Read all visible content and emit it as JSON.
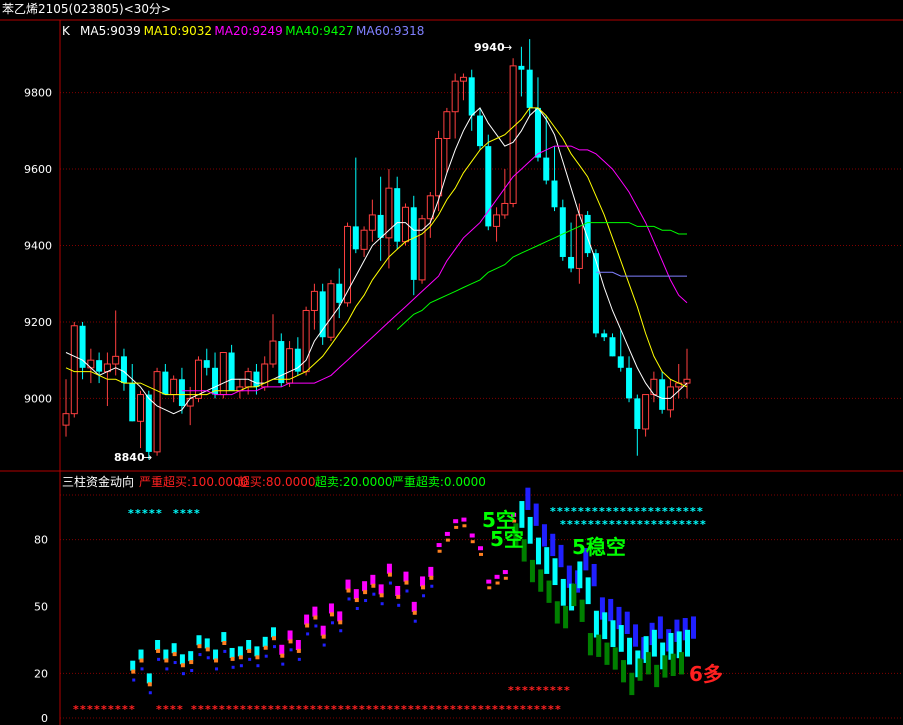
{
  "window": {
    "symbol": "苯乙烯2105",
    "code": "(023805)",
    "period": "<30分>"
  },
  "upper_panel": {
    "label": "K",
    "ma_legend": [
      {
        "text": "MA5:9039",
        "color": "#ffffff"
      },
      {
        "text": "MA10:9032",
        "color": "#ffff00"
      },
      {
        "text": "MA20:9249",
        "color": "#ff00ff"
      },
      {
        "text": "MA40:9427",
        "color": "#00ff00"
      },
      {
        "text": "MA60:9318",
        "color": "#8080ff"
      }
    ],
    "high_marker": "9940",
    "low_marker": "8840",
    "y_ticks": [
      "9800",
      "9600",
      "9400",
      "9200",
      "9000"
    ]
  },
  "lower_panel": {
    "title": "三柱资金动向",
    "legend": [
      {
        "text": "严重超买:100.0000",
        "color": "#ff2020"
      },
      {
        "text": "超买:80.0000",
        "color": "#ff2020"
      },
      {
        "text": "超卖:20.0000",
        "color": "#00ff00"
      },
      {
        "text": "严重超卖:0.0000",
        "color": "#00ff00"
      }
    ],
    "y_ticks": [
      "80",
      "50",
      "20",
      "0"
    ],
    "annotations": [
      {
        "text": "5空",
        "color": "#00ff00"
      },
      {
        "text": "5空",
        "color": "#00ff00"
      },
      {
        "text": "5稳空",
        "color": "#00ff00"
      },
      {
        "text": "6多",
        "color": "#ff2020"
      }
    ]
  },
  "colors": {
    "up": "#ff4040",
    "down": "#00ffff",
    "grid": "#800000",
    "axis": "#b00000"
  },
  "chart_data": [
    {
      "type": "candlestick",
      "title": "",
      "ylim": [
        8810,
        9990
      ],
      "y_ticks": [
        9000,
        9200,
        9400,
        9600,
        9800
      ],
      "grid": true,
      "series": [
        {
          "name": "K",
          "ohlc": [
            [
              8930,
              9050,
              8900,
              8960
            ],
            [
              8960,
              9200,
              8950,
              9190
            ],
            [
              9190,
              9200,
              9050,
              9080
            ],
            [
              9080,
              9130,
              9040,
              9100
            ],
            [
              9100,
              9120,
              9040,
              9070
            ],
            [
              9070,
              9120,
              8980,
              9090
            ],
            [
              9090,
              9230,
              9060,
              9110
            ],
            [
              9110,
              9130,
              9020,
              9040
            ],
            [
              9040,
              9090,
              8940,
              8940
            ],
            [
              8940,
              9020,
              8870,
              9010
            ],
            [
              9010,
              9020,
              8840,
              8860
            ],
            [
              8860,
              9080,
              8850,
              9070
            ],
            [
              9070,
              9090,
              9010,
              9010
            ],
            [
              9010,
              9060,
              8990,
              9050
            ],
            [
              9050,
              9080,
              8960,
              8980
            ],
            [
              8980,
              9030,
              8930,
              9000
            ],
            [
              9000,
              9110,
              8990,
              9100
            ],
            [
              9100,
              9130,
              9060,
              9080
            ],
            [
              9080,
              9120,
              9000,
              9010
            ],
            [
              9010,
              9120,
              9000,
              9120
            ],
            [
              9120,
              9140,
              9020,
              9020
            ],
            [
              9020,
              9050,
              9000,
              9030
            ],
            [
              9030,
              9080,
              9010,
              9070
            ],
            [
              9070,
              9090,
              9010,
              9030
            ],
            [
              9030,
              9110,
              9020,
              9090
            ],
            [
              9090,
              9220,
              9080,
              9150
            ],
            [
              9150,
              9170,
              9030,
              9040
            ],
            [
              9040,
              9150,
              9030,
              9130
            ],
            [
              9130,
              9160,
              9060,
              9070
            ],
            [
              9070,
              9240,
              9060,
              9230
            ],
            [
              9230,
              9300,
              9180,
              9280
            ],
            [
              9280,
              9300,
              9140,
              9160
            ],
            [
              9160,
              9310,
              9150,
              9300
            ],
            [
              9300,
              9340,
              9210,
              9250
            ],
            [
              9250,
              9460,
              9240,
              9450
            ],
            [
              9450,
              9630,
              9380,
              9390
            ],
            [
              9390,
              9450,
              9370,
              9440
            ],
            [
              9440,
              9520,
              9410,
              9480
            ],
            [
              9480,
              9580,
              9360,
              9420
            ],
            [
              9420,
              9600,
              9340,
              9550
            ],
            [
              9550,
              9580,
              9390,
              9410
            ],
            [
              9410,
              9510,
              9400,
              9500
            ],
            [
              9500,
              9530,
              9270,
              9310
            ],
            [
              9310,
              9480,
              9300,
              9470
            ],
            [
              9470,
              9540,
              9420,
              9530
            ],
            [
              9530,
              9700,
              9490,
              9680
            ],
            [
              9680,
              9760,
              9590,
              9750
            ],
            [
              9750,
              9850,
              9680,
              9830
            ],
            [
              9830,
              9850,
              9780,
              9840
            ],
            [
              9840,
              9860,
              9700,
              9740
            ],
            [
              9740,
              9760,
              9650,
              9660
            ],
            [
              9660,
              9690,
              9440,
              9450
            ],
            [
              9450,
              9500,
              9410,
              9480
            ],
            [
              9480,
              9600,
              9470,
              9510
            ],
            [
              9510,
              9890,
              9500,
              9870
            ],
            [
              9870,
              9920,
              9790,
              9860
            ],
            [
              9860,
              9940,
              9740,
              9760
            ],
            [
              9760,
              9840,
              9620,
              9630
            ],
            [
              9630,
              9740,
              9560,
              9570
            ],
            [
              9570,
              9660,
              9490,
              9500
            ],
            [
              9500,
              9520,
              9360,
              9370
            ],
            [
              9370,
              9460,
              9330,
              9340
            ],
            [
              9340,
              9510,
              9300,
              9480
            ],
            [
              9480,
              9490,
              9370,
              9380
            ],
            [
              9380,
              9390,
              9160,
              9170
            ],
            [
              9170,
              9180,
              9150,
              9160
            ],
            [
              9160,
              9170,
              9110,
              9110
            ],
            [
              9110,
              9180,
              9070,
              9080
            ],
            [
              9080,
              9110,
              8990,
              9000
            ],
            [
              9000,
              9010,
              8850,
              8920
            ],
            [
              8920,
              9010,
              8900,
              9010
            ],
            [
              9010,
              9070,
              8990,
              9050
            ],
            [
              9050,
              9070,
              8960,
              8970
            ],
            [
              8970,
              9050,
              8950,
              9030
            ],
            [
              9030,
              9090,
              9000,
              9040
            ],
            [
              9040,
              9130,
              9000,
              9050
            ]
          ]
        },
        {
          "name": "MA5",
          "color": "#ffffff",
          "values": [
            9120,
            9110,
            9100,
            9080,
            9060,
            9070,
            9080,
            9070,
            9050,
            9030,
            9000,
            8980,
            8970,
            8960,
            8970,
            9000,
            9010,
            9020,
            9030,
            9040,
            9050,
            9050,
            9050,
            9040,
            9040,
            9050,
            9060,
            9070,
            9080,
            9100,
            9150,
            9180,
            9210,
            9240,
            9280,
            9320,
            9360,
            9400,
            9420,
            9440,
            9460,
            9460,
            9440,
            9440,
            9460,
            9520,
            9590,
            9650,
            9700,
            9740,
            9760,
            9720,
            9690,
            9660,
            9670,
            9700,
            9740,
            9760,
            9730,
            9690,
            9620,
            9550,
            9480,
            9420,
            9360,
            9290,
            9230,
            9180,
            9130,
            9080,
            9040,
            9010,
            9000,
            9000,
            9020,
            9040
          ]
        },
        {
          "name": "MA10",
          "color": "#ffff00",
          "values": [
            9080,
            9070,
            9070,
            9070,
            9060,
            9050,
            9050,
            9040,
            9040,
            9040,
            9030,
            9020,
            9010,
            9010,
            9010,
            9010,
            9010,
            9010,
            9020,
            9020,
            9020,
            9020,
            9030,
            9030,
            9040,
            9050,
            9050,
            9050,
            9060,
            9070,
            9090,
            9110,
            9140,
            9170,
            9200,
            9240,
            9270,
            9310,
            9340,
            9370,
            9390,
            9410,
            9420,
            9430,
            9450,
            9480,
            9520,
            9550,
            9590,
            9620,
            9650,
            9670,
            9680,
            9690,
            9710,
            9730,
            9760,
            9760,
            9740,
            9710,
            9680,
            9640,
            9610,
            9580,
            9530,
            9480,
            9420,
            9360,
            9300,
            9240,
            9170,
            9110,
            9070,
            9050,
            9040,
            9030
          ]
        },
        {
          "name": "MA20",
          "color": "#ff00ff",
          "values": [
            null,
            null,
            null,
            null,
            null,
            null,
            null,
            null,
            null,
            null,
            null,
            null,
            null,
            null,
            9020,
            9020,
            9020,
            9020,
            9010,
            9010,
            9010,
            9020,
            9020,
            9020,
            9030,
            9030,
            9030,
            9040,
            9040,
            9040,
            9040,
            9050,
            9060,
            9080,
            9100,
            9120,
            9140,
            9160,
            9180,
            9200,
            9220,
            9240,
            9260,
            9280,
            9300,
            9320,
            9360,
            9390,
            9420,
            9440,
            9460,
            9490,
            9520,
            9550,
            9580,
            9600,
            9620,
            9640,
            9650,
            9660,
            9660,
            9660,
            9650,
            9650,
            9640,
            9620,
            9600,
            9570,
            9540,
            9500,
            9460,
            9410,
            9360,
            9310,
            9270,
            9250
          ]
        },
        {
          "name": "MA40",
          "color": "#00ff00",
          "values": [
            null,
            null,
            null,
            null,
            null,
            null,
            null,
            null,
            null,
            null,
            null,
            null,
            null,
            null,
            null,
            null,
            null,
            null,
            null,
            null,
            null,
            null,
            null,
            null,
            null,
            null,
            null,
            null,
            null,
            null,
            null,
            null,
            null,
            null,
            null,
            null,
            null,
            null,
            null,
            null,
            9180,
            9200,
            9220,
            9230,
            9250,
            9260,
            9270,
            9280,
            9290,
            9300,
            9310,
            9330,
            9340,
            9350,
            9370,
            9380,
            9390,
            9400,
            9410,
            9420,
            9430,
            9440,
            9450,
            9460,
            9460,
            9460,
            9460,
            9460,
            9460,
            9450,
            9450,
            9450,
            9440,
            9440,
            9430,
            9430
          ]
        },
        {
          "name": "MA60",
          "color": "#8080ff",
          "values": [
            null,
            null,
            null,
            null,
            null,
            null,
            null,
            null,
            null,
            null,
            null,
            null,
            null,
            null,
            null,
            null,
            null,
            null,
            null,
            null,
            null,
            null,
            null,
            null,
            null,
            null,
            null,
            null,
            null,
            null,
            null,
            null,
            null,
            null,
            null,
            null,
            null,
            null,
            null,
            null,
            null,
            null,
            null,
            null,
            null,
            null,
            null,
            null,
            null,
            null,
            null,
            null,
            null,
            null,
            null,
            null,
            null,
            null,
            null,
            null,
            null,
            null,
            null,
            null,
            9330,
            9330,
            9330,
            9320,
            9320,
            9320,
            9320,
            9320,
            9320,
            9320,
            9320,
            9320
          ]
        }
      ]
    },
    {
      "type": "bar",
      "title": "三柱资金动向",
      "ylim": [
        0,
        100
      ],
      "y_ticks": [
        0,
        20,
        50,
        80
      ],
      "reference_lines": [
        100,
        80,
        20,
        0
      ],
      "series": [
        {
          "name": "A",
          "values": [
            null,
            null,
            null,
            null,
            null,
            null,
            null,
            null,
            null,
            null,
            null,
            null,
            null,
            null,
            null,
            null,
            null,
            null,
            null,
            null,
            null,
            null,
            null,
            null,
            null,
            null,
            null,
            null,
            null,
            null,
            null,
            null,
            null,
            null,
            null,
            null,
            null,
            null,
            null,
            null,
            null,
            null,
            null,
            null,
            null,
            null,
            null,
            null,
            null,
            null,
            null,
            null,
            null,
            null,
            null,
            null,
            null,
            null,
            null,
            null,
            null,
            null,
            null,
            null,
            null,
            null,
            null,
            null,
            null,
            null,
            null,
            null,
            null,
            null,
            null,
            null
          ]
        }
      ]
    }
  ]
}
